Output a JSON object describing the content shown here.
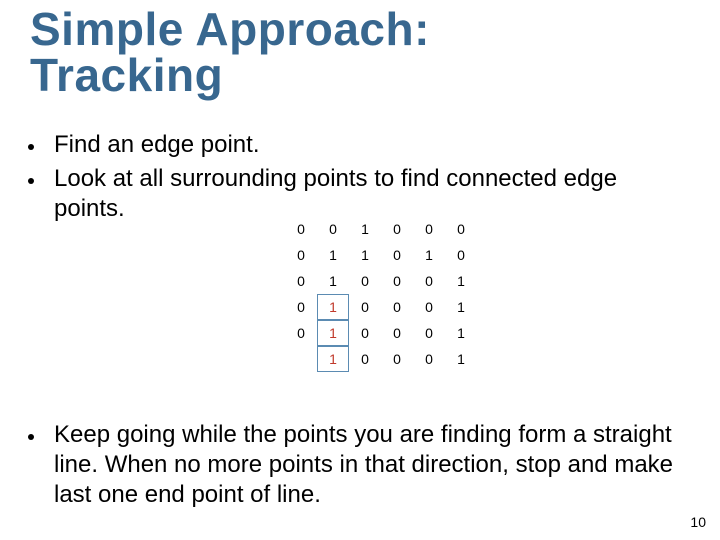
{
  "title_line1": "Simple Approach:",
  "title_line2": "Tracking",
  "bullets": {
    "b1": "Find an edge point.",
    "b2": "Look at all surrounding points to find connected edge points.",
    "b3": "Keep going while the points you are finding form a straight line. When no more points in that direction, stop and make last one end point of line."
  },
  "matrix": {
    "rows": [
      [
        "0",
        "0",
        "1",
        "0",
        "0",
        "0"
      ],
      [
        "0",
        "1",
        "1",
        "0",
        "1",
        "0"
      ],
      [
        "0",
        "1",
        "0",
        "0",
        "0",
        "1"
      ],
      [
        "0",
        "1",
        "0",
        "0",
        "0",
        "1"
      ],
      [
        "0",
        "1",
        "0",
        "0",
        "0",
        "1"
      ],
      [
        "",
        "1",
        "0",
        "0",
        "0",
        "1"
      ]
    ],
    "edge_cells": [
      "3,1",
      "4,1",
      "5,1"
    ]
  },
  "page_number": "10"
}
